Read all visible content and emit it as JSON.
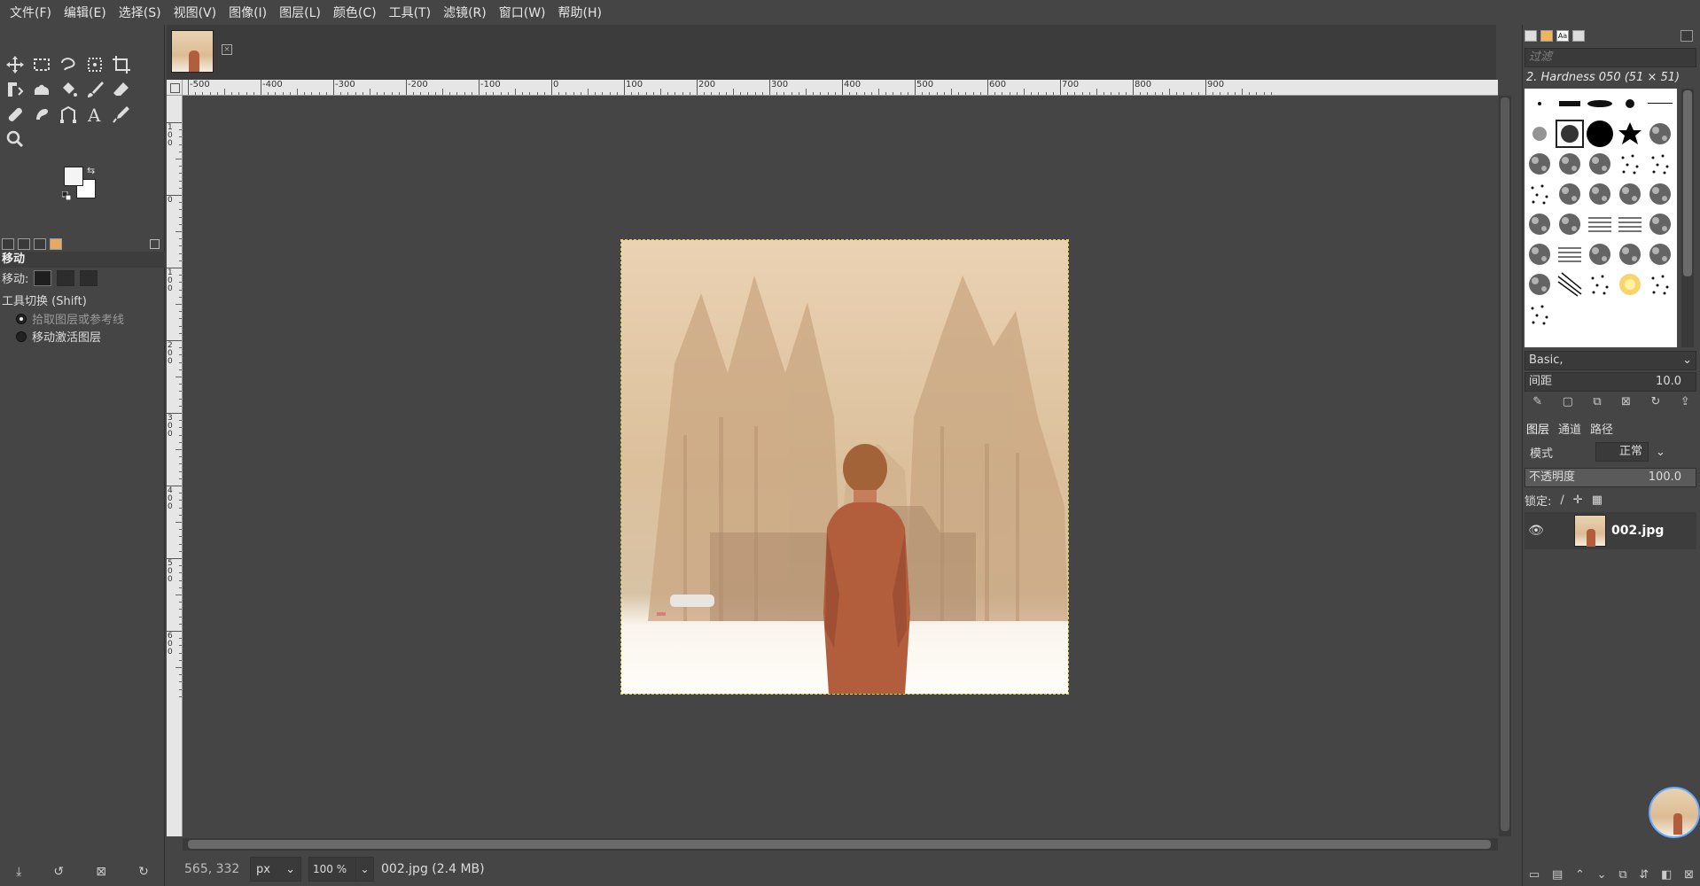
{
  "menu": [
    "文件(F)",
    "编辑(E)",
    "选择(S)",
    "视图(V)",
    "图像(I)",
    "图层(L)",
    "颜色(C)",
    "工具(T)",
    "滤镜(R)",
    "窗口(W)",
    "帮助(H)"
  ],
  "toolbox": {
    "tools": [
      {
        "name": "move-tool-icon",
        "glyph": "✥"
      },
      {
        "name": "rect-select-tool-icon",
        "glyph": "⬚"
      },
      {
        "name": "free-select-tool-icon",
        "glyph": "ℓ"
      },
      {
        "name": "fuzzy-select-tool-icon",
        "glyph": "⁙"
      },
      {
        "name": "crop-tool-icon",
        "glyph": "⌗"
      },
      {
        "name": "transform-tool-icon",
        "glyph": "⊡"
      },
      {
        "name": "warp-tool-icon",
        "glyph": "☁"
      },
      {
        "name": "bucket-fill-tool-icon",
        "glyph": "⛾"
      },
      {
        "name": "paintbrush-tool-icon",
        "glyph": "∕"
      },
      {
        "name": "eraser-tool-icon",
        "glyph": "▰"
      },
      {
        "name": "heal-tool-icon",
        "glyph": "✚"
      },
      {
        "name": "smudge-tool-icon",
        "glyph": "☝"
      },
      {
        "name": "paths-tool-icon",
        "glyph": "⟟"
      },
      {
        "name": "text-tool-icon",
        "glyph": "A"
      },
      {
        "name": "color-picker-tool-icon",
        "glyph": "∤"
      },
      {
        "name": "zoom-tool-icon",
        "glyph": "⚲"
      }
    ],
    "options_title": "移动",
    "move_label": "移动:",
    "tool_switch_label": "工具切换 (Shift)",
    "radio_pick": "拾取图层或参考线",
    "radio_active": "移动激活图层"
  },
  "ruler_top": [
    "-500",
    "-400",
    "-300",
    "-200",
    "-100",
    "0",
    "100",
    "200",
    "300",
    "400",
    "500",
    "600",
    "700",
    "800",
    "900"
  ],
  "ruler_left": [
    "1\n0\n0",
    "0",
    "1\n0\n0",
    "2\n0\n0",
    "3\n0\n0",
    "4\n0\n0",
    "5\n0\n0",
    "6\n0\n0"
  ],
  "statusbar": {
    "coords": "565, 332",
    "unit": "px",
    "zoom": "100 %",
    "message": "002.jpg (2.4 MB)"
  },
  "right_panel": {
    "filter_placeholder": "过滤",
    "brush_name": "2. Hardness 050 (51 × 51)",
    "brush_set": "Basic,",
    "spacing_label": "间距",
    "spacing_value": "10.0",
    "tabs": {
      "layers": "图层",
      "channels": "通道",
      "paths": "路径"
    },
    "mode_label": "模式",
    "mode_value": "正常",
    "opacity_label": "不透明度",
    "opacity_value": "100.0",
    "lock_label": "锁定:",
    "layer_name": "002.jpg"
  },
  "colors": {
    "bg": "#454545",
    "selection_outline": "#e3d442",
    "coat": "#b25e3d",
    "accent_blue": "#66aaff"
  }
}
